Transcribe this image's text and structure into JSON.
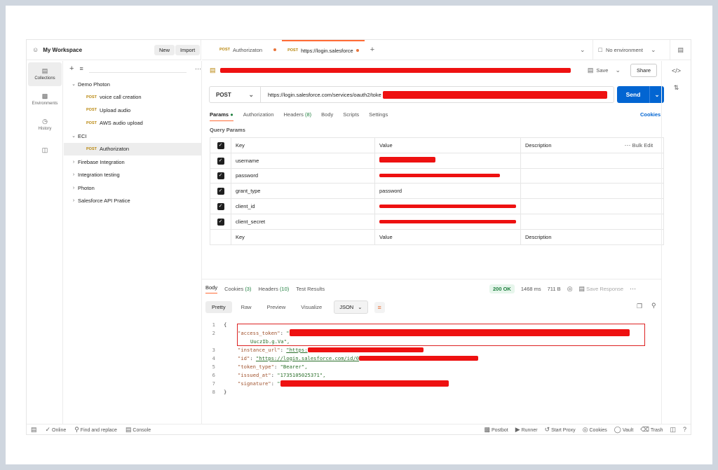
{
  "header": {
    "workspace": "My Workspace",
    "new_label": "New",
    "import_label": "Import"
  },
  "tabs": [
    {
      "method": "POST",
      "label": "Authorizaton"
    },
    {
      "method": "POST",
      "label": "https://login.salesforce"
    }
  ],
  "environment": "No environment",
  "rail": [
    {
      "label": "Collections",
      "icon": "collections-icon"
    },
    {
      "label": "Environments",
      "icon": "environments-icon"
    },
    {
      "label": "History",
      "icon": "history-icon"
    },
    {
      "label": "",
      "icon": "apps-icon"
    }
  ],
  "tree": [
    {
      "label": "Demo Photon",
      "type": "folder",
      "depth": 0,
      "open": true
    },
    {
      "label": "voice call creation",
      "type": "request",
      "method": "POST",
      "depth": 1
    },
    {
      "label": "Upload audio",
      "type": "request",
      "method": "POST",
      "depth": 1
    },
    {
      "label": "AWS audio upload",
      "type": "request",
      "method": "POST",
      "depth": 1
    },
    {
      "label": "ECI",
      "type": "folder",
      "depth": 0,
      "open": true
    },
    {
      "label": "Authorizaton",
      "type": "request",
      "method": "POST",
      "depth": 1,
      "active": true
    },
    {
      "label": "Firebase Integration",
      "type": "folder",
      "depth": 0
    },
    {
      "label": "Integration testing",
      "type": "folder",
      "depth": 0
    },
    {
      "label": "Photon",
      "type": "folder",
      "depth": 0
    },
    {
      "label": "Salesforce API Pratice",
      "type": "folder",
      "depth": 0
    }
  ],
  "request": {
    "save_label": "Save",
    "share_label": "Share",
    "method": "POST",
    "url": "https://login.salesforce.com/services/oauth2/toke",
    "send_label": "Send",
    "sub_tabs": [
      "Params",
      "Authorization",
      "Headers",
      "Body",
      "Scripts",
      "Settings"
    ],
    "headers_count": "(8)",
    "cookies_label": "Cookies",
    "query_title": "Query Params",
    "columns": [
      "Key",
      "Value",
      "Description"
    ],
    "bulk_edit": "Bulk Edit",
    "params": [
      {
        "key": "username",
        "value": ""
      },
      {
        "key": "password",
        "value": ""
      },
      {
        "key": "grant_type",
        "value": "password"
      },
      {
        "key": "client_id",
        "value": ""
      },
      {
        "key": "client_secret",
        "value": ""
      }
    ],
    "placeholder_key": "Key",
    "placeholder_value": "Value",
    "placeholder_desc": "Description"
  },
  "response": {
    "tabs": [
      "Body",
      "Cookies",
      "Headers",
      "Test Results"
    ],
    "cookies_count": "(3)",
    "headers_count": "(10)",
    "status": "200 OK",
    "time": "1468 ms",
    "size": "711 B",
    "save_response": "Save Response",
    "formats": [
      "Pretty",
      "Raw",
      "Preview",
      "Visualize"
    ],
    "format_selected": "JSON",
    "lines": [
      {
        "n": "1",
        "text": "{"
      },
      {
        "n": "2",
        "key": "\"access_token\"",
        "val": "\""
      },
      {
        "n": "",
        "cont": "UuczIb.g.Va\","
      },
      {
        "n": "3",
        "key": "\"instance_url\"",
        "val": "\"https:"
      },
      {
        "n": "4",
        "key": "\"id\"",
        "val": "\"https://login.salesforce.com/id/0"
      },
      {
        "n": "5",
        "key": "\"token_type\"",
        "val": "\"Bearer\","
      },
      {
        "n": "6",
        "key": "\"issued_at\"",
        "val": "\"1735105025371\","
      },
      {
        "n": "7",
        "key": "\"signature\"",
        "val": "\""
      },
      {
        "n": "8",
        "text": "}"
      }
    ]
  },
  "status_bar": {
    "online": "Online",
    "find_replace": "Find and replace",
    "console": "Console",
    "postbot": "Postbot",
    "runner": "Runner",
    "start_proxy": "Start Proxy",
    "cookies": "Cookies",
    "vault": "Vault",
    "trash": "Trash"
  },
  "colors": {
    "accent": "#ff6c37",
    "send": "#0265d2",
    "redaction": "#ee1111"
  }
}
